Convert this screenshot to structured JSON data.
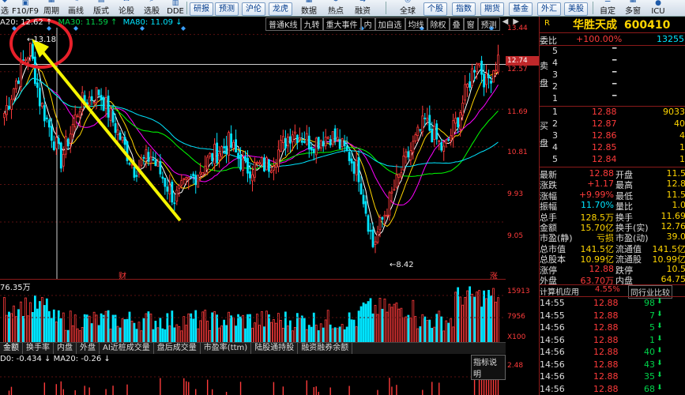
{
  "toolbar": {
    "left_items": [
      "选",
      "F10/F9",
      "周期",
      "画线",
      "版式",
      "论股",
      "选股",
      "DDE"
    ],
    "buttons": [
      "研报",
      "预测",
      "沪伦",
      "龙虎",
      "数据",
      "热点",
      "融资",
      "全球",
      "个股",
      "指数",
      "期货",
      "基金",
      "外汇",
      "美股"
    ],
    "right_items": [
      "自定",
      "多窗",
      "ICU"
    ]
  },
  "chart": {
    "ma_line": {
      "ma20": "A20: 12.62 ↑",
      "ma30": "MA30: 11.59 ↑",
      "ma80": "MA80: 11.09 ↓"
    },
    "menu": [
      "普通K线",
      "九转",
      "重大事件",
      "内",
      "加自选",
      "均线",
      "除权",
      "叠",
      "窗",
      "预测"
    ],
    "high_label": "13.18",
    "low_label": "8.42",
    "cursor_price": "12.74",
    "axis_prices": [
      "13.44",
      "12.57",
      "11.69",
      "10.81",
      "9.93",
      "9.05"
    ],
    "marker_cai": "财",
    "marker_zhang": "涨",
    "volume_label": "76.35万",
    "vol_axis": [
      "15913",
      "7956",
      "X100"
    ],
    "tabs": [
      "金额",
      "换手率",
      "内盘",
      "外盘",
      "AI近桩成交量",
      "盘后成交量",
      "市盈率(ttm)",
      "陆股通持股",
      "融资融券余额"
    ],
    "indicator_line": "D0: -0.434 ↓   MA20: -0.26 ↓",
    "indicator_axis": "2.48",
    "indicator_help": "指标说明"
  },
  "panel": {
    "header_label": "R",
    "name": "华胜天成",
    "code": "600410",
    "weibi_label": "委比",
    "weibi_value": "+100.00%",
    "weibi_right": "13255",
    "sell_label": "卖盘",
    "buy_label": "买盘",
    "sell_levels": [
      "5",
      "4",
      "3",
      "2",
      "1"
    ],
    "sell_prices": [
      "",
      "",
      "",
      "",
      ""
    ],
    "buy_levels": [
      "1",
      "2",
      "3",
      "4",
      "5"
    ],
    "buy_prices": [
      "12.88",
      "12.87",
      "12.86",
      "12.85",
      "12.84"
    ],
    "buy_vols": [
      "9033",
      "40",
      "4",
      "1",
      "1"
    ],
    "stats": [
      {
        "l1": "最新",
        "v1": "12.88",
        "l2": "开盘",
        "v2": "11.5"
      },
      {
        "l1": "涨跌",
        "v1": "+1.17",
        "l2": "最高",
        "v2": "12.8"
      },
      {
        "l1": "涨幅",
        "v1": "+9.99%",
        "l2": "最低",
        "v2": "11.5"
      },
      {
        "l1": "振幅",
        "v1": "11.70%",
        "l2": "量比",
        "v2": "1.0"
      },
      {
        "l1": "总手",
        "v1": "128.5万",
        "l2": "换手",
        "v2": "11.69"
      },
      {
        "l1": "金额",
        "v1": "15.70亿",
        "l2": "换手(实)",
        "v2": "12.76"
      },
      {
        "l1": "市盈(静)",
        "v1": "亏损",
        "l2": "市盈(动)",
        "v2": "39.0"
      },
      {
        "l1": "总市值",
        "v1": "141.5亿",
        "l2": "流通值",
        "v2": "141.5亿"
      },
      {
        "l1": "总股本",
        "v1": "10.99亿",
        "l2": "流通股",
        "v2": "10.99亿"
      },
      {
        "l1": "涨停",
        "v1": "12.88",
        "l2": "跌停",
        "v2": "10.5"
      },
      {
        "l1": "外盘",
        "v1": "63.70万",
        "l2": "内盘",
        "v2": "64.75"
      }
    ],
    "sector_name": "计算机应用",
    "sector_change": "4.55%",
    "sector_link": "同行业比较",
    "ticks": [
      {
        "time": "14:55",
        "price": "12.88",
        "vol": "98",
        "dir": "down"
      },
      {
        "time": "14:55",
        "price": "12.88",
        "vol": "7",
        "dir": "down"
      },
      {
        "time": "14:56",
        "price": "12.88",
        "vol": "5",
        "dir": "down"
      },
      {
        "time": "14:56",
        "price": "12.88",
        "vol": "1",
        "dir": "down"
      },
      {
        "time": "14:56",
        "price": "12.88",
        "vol": "40",
        "dir": "down"
      },
      {
        "time": "14:56",
        "price": "12.88",
        "vol": "43",
        "dir": "down"
      },
      {
        "time": "14:56",
        "price": "12.88",
        "vol": "35",
        "dir": "down"
      },
      {
        "time": "14:56",
        "price": "12.88",
        "vol": "68",
        "dir": "down"
      }
    ]
  },
  "colors": {
    "up": "#ff3b3b",
    "down": "#00e5ff",
    "ma5": "#ffffff",
    "ma10": "#ffd500",
    "ma20": "#ff00ff",
    "ma60": "#00ff00",
    "ma80": "#00e5ff",
    "arrow": "#f5f500",
    "circle": "#e8202a"
  }
}
